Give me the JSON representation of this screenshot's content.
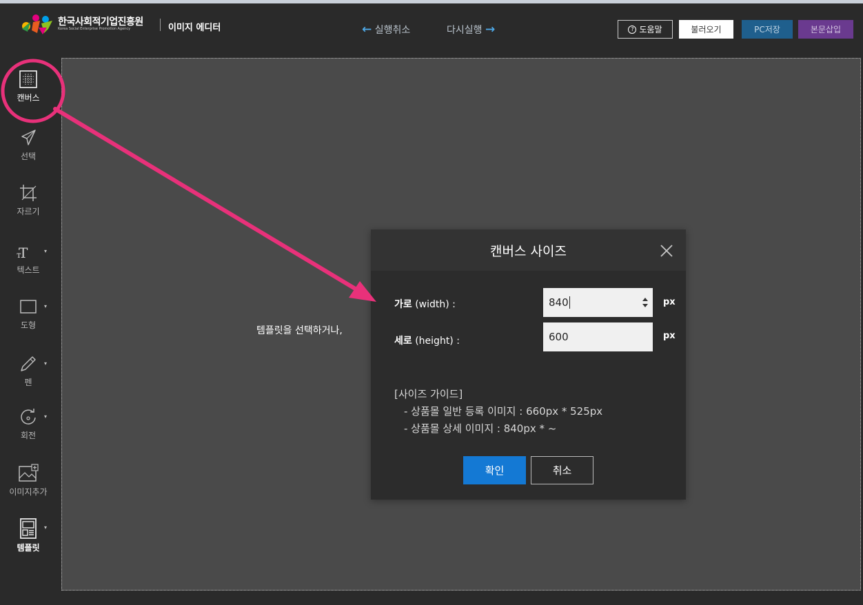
{
  "header": {
    "org_name": "한국사회적기업진흥원",
    "org_sub": "Korea Social Enterprise Promotion Agency",
    "editor_title": "이미지 에디터",
    "undo_label": "실행취소",
    "redo_label": "다시실행",
    "help_label": "도움말",
    "load_label": "불러오기",
    "save_pc_label": "PC저장",
    "insert_label": "본문삽입"
  },
  "sidebar": {
    "items": [
      {
        "label": "캔버스",
        "icon": "canvas-grid-icon",
        "active": true
      },
      {
        "label": "선택",
        "icon": "cursor-arrow-icon"
      },
      {
        "label": "자르기",
        "icon": "crop-icon"
      },
      {
        "label": "텍스트",
        "icon": "text-icon"
      },
      {
        "label": "도형",
        "icon": "rectangle-shape-icon"
      },
      {
        "label": "펜",
        "icon": "pen-icon"
      },
      {
        "label": "회전",
        "icon": "rotate-icon"
      },
      {
        "label": "이미지추가",
        "icon": "add-image-icon"
      },
      {
        "label": "템플릿",
        "icon": "template-icon"
      }
    ]
  },
  "canvas": {
    "hint_text": "템플릿을 선택하거나,"
  },
  "dialog": {
    "title": "캔버스 사이즈",
    "width_label_ko": "가로",
    "width_label_en": "(width) :",
    "height_label_ko": "세로",
    "height_label_en": "(height) :",
    "width_value": "840",
    "height_value": "600",
    "unit": "px",
    "guide_title": "[사이즈 가이드]",
    "guide_line1": "- 상품몰 일반 등록 이미지 : 660px * 525px",
    "guide_line2": "- 상품몰 상세 이미지 : 840px * ~",
    "confirm_label": "확인",
    "cancel_label": "취소"
  },
  "colors": {
    "annotation": "#e8317a",
    "primary": "#1479d4",
    "pc_save": "#1f5f8d",
    "insert": "#6a3a8f"
  }
}
